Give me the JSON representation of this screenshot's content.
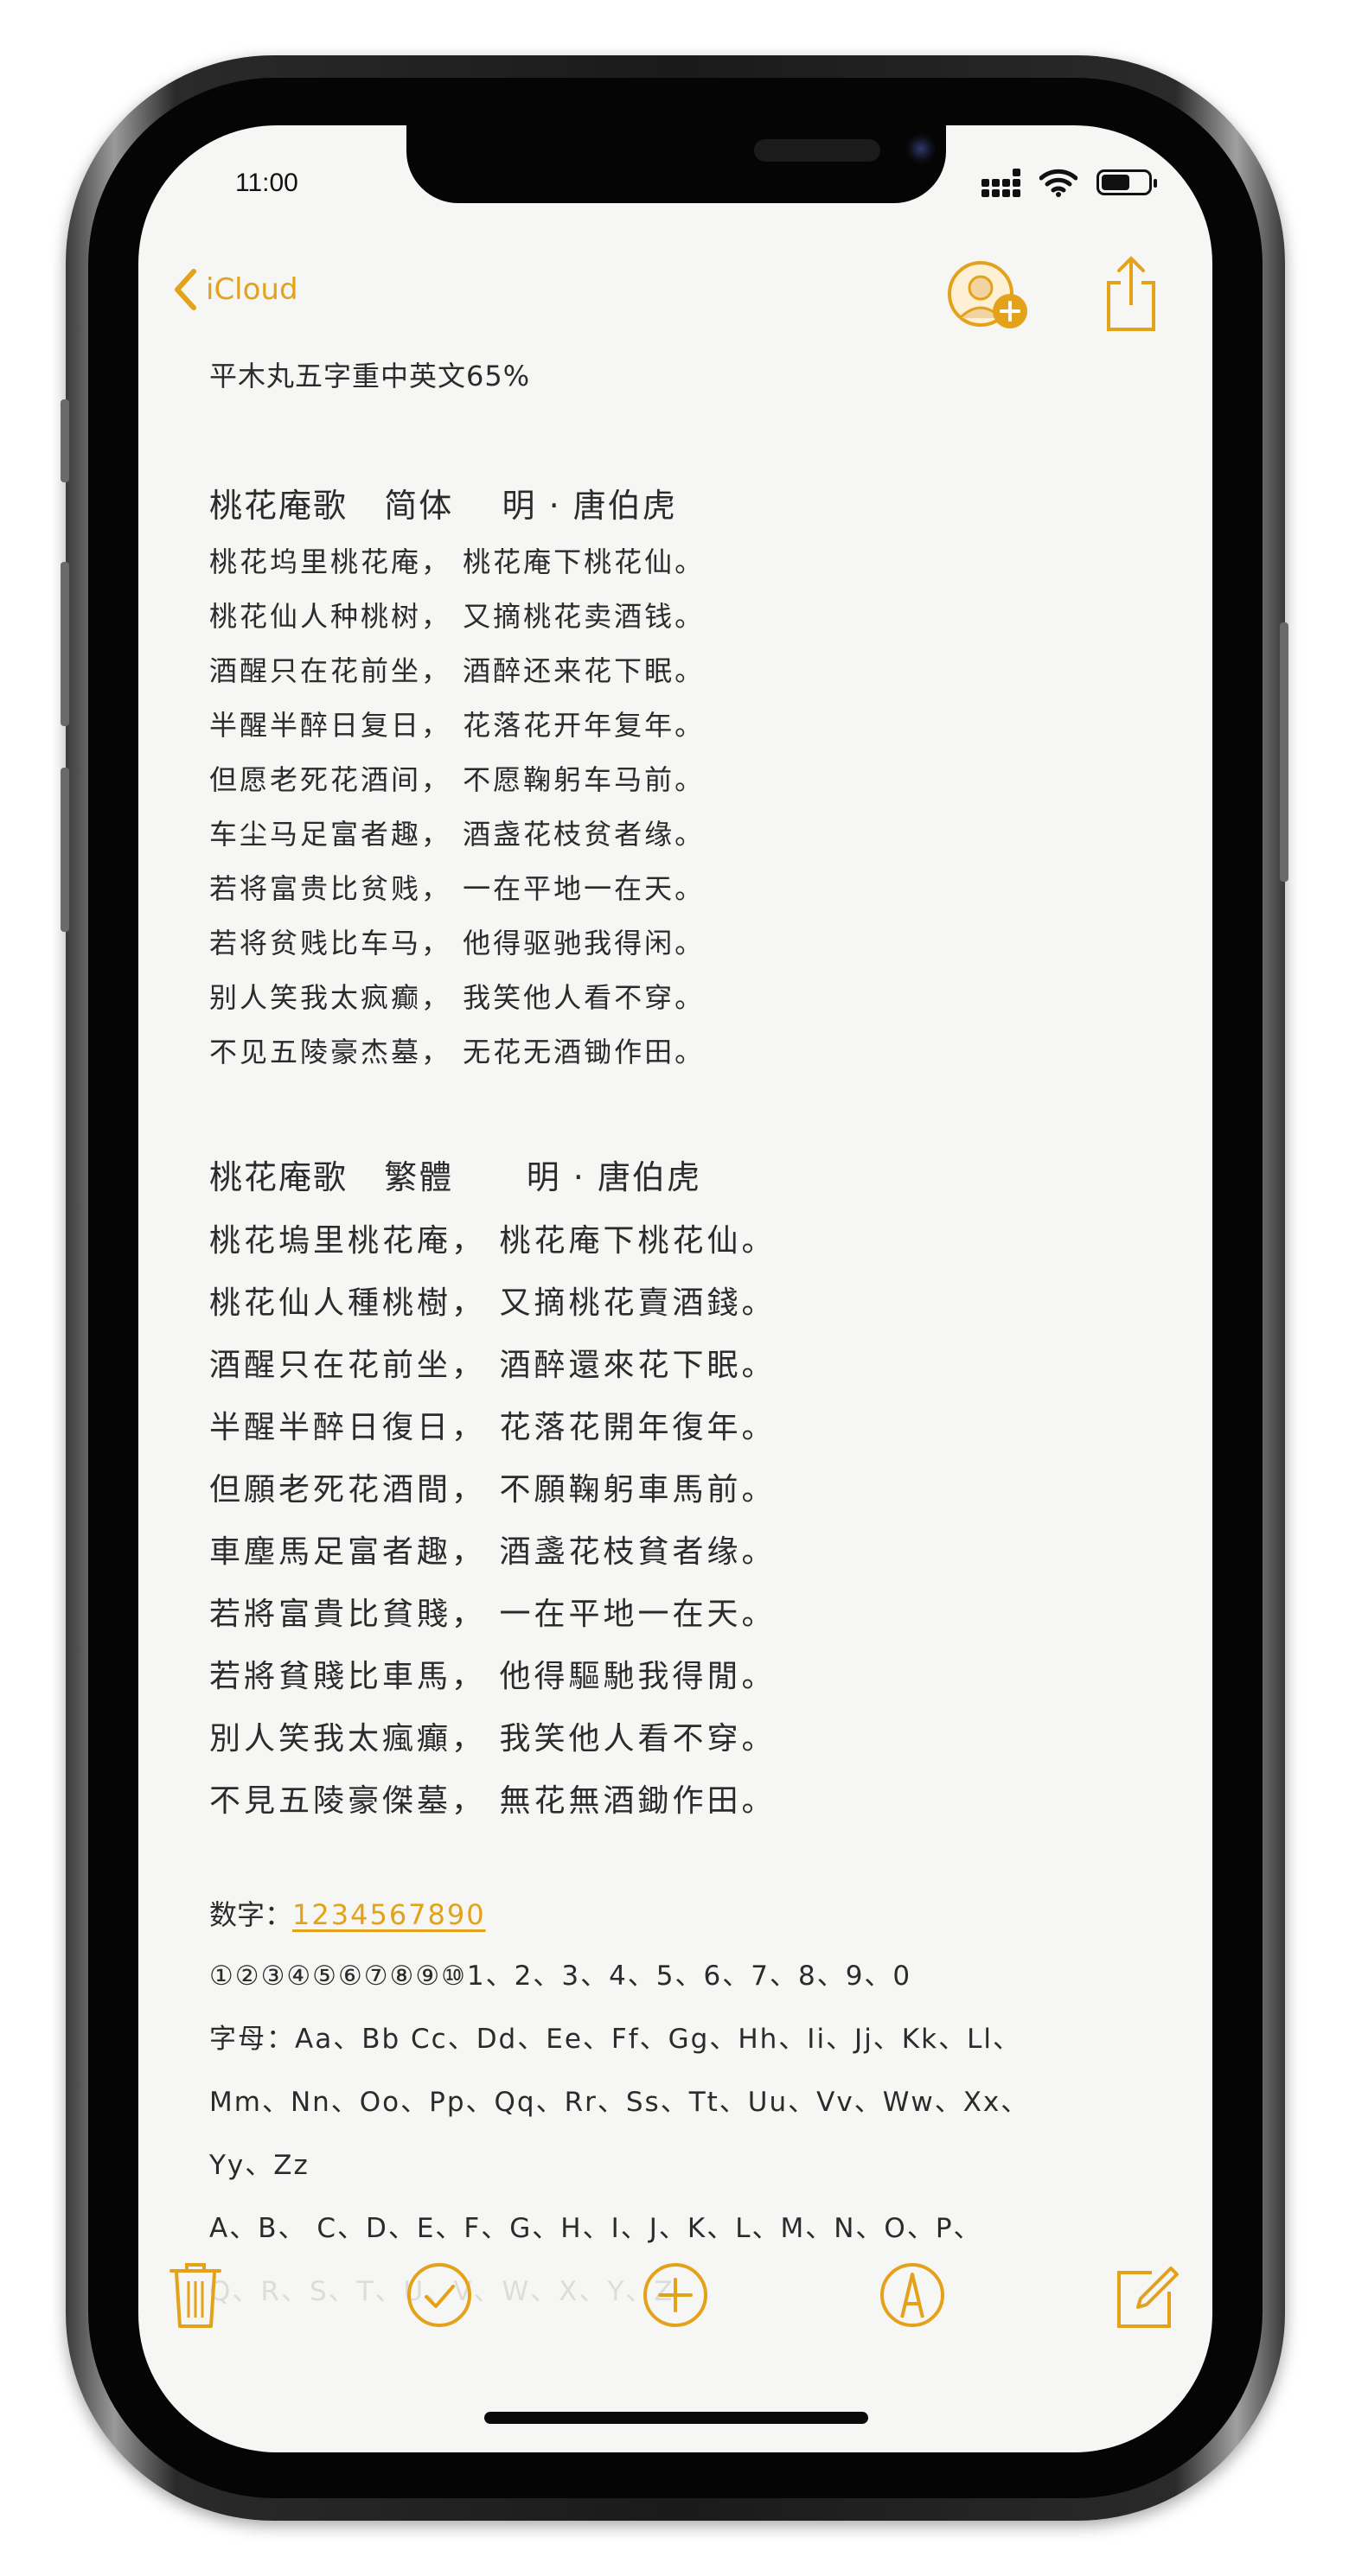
{
  "status_bar": {
    "time": "11:00",
    "battery_level": 0.65
  },
  "nav": {
    "back_label": "iCloud",
    "back_icon": "chevron-left-icon",
    "people_icon": "add-person-icon",
    "share_icon": "share-icon"
  },
  "colors": {
    "accent": "#e3a21a",
    "text": "#2b2b2b",
    "paper": "#f6f6f4"
  },
  "note": {
    "font_note": "平木丸五字重中英文65%",
    "poem_simplified": {
      "title": "桃花庵歌   简体    明 · 唐伯虎",
      "lines": [
        "桃花坞里桃花庵， 桃花庵下桃花仙。",
        "桃花仙人种桃树， 又摘桃花卖酒钱。",
        "酒醒只在花前坐， 酒醉还来花下眠。",
        "半醒半醉日复日， 花落花开年复年。",
        "但愿老死花酒间， 不愿鞠躬车马前。",
        "车尘马足富者趣， 酒盏花枝贫者缘。",
        "若将富贵比贫贱， 一在平地一在天。",
        "若将贫贱比车马， 他得驱驰我得闲。",
        "别人笑我太疯癫， 我笑他人看不穿。",
        "不见五陵豪杰墓， 无花无酒锄作田。"
      ]
    },
    "poem_traditional": {
      "title": "桃花庵歌   繁體      明 · 唐伯虎",
      "lines": [
        "桃花塢里桃花庵， 桃花庵下桃花仙。",
        "桃花仙人種桃樹， 又摘桃花賣酒錢。",
        "酒醒只在花前坐， 酒醉還來花下眠。",
        "半醒半醉日復日， 花落花開年復年。",
        "但願老死花酒間， 不願鞠躬車馬前。",
        "車塵馬足富者趣， 酒盞花枝貧者缘。",
        "若將富貴比貧賤， 一在平地一在天。",
        "若將貧賤比車馬， 他得驅馳我得閒。",
        "別人笑我太瘋癲， 我笑他人看不穿。",
        "不見五陵豪傑墓， 無花無酒鋤作田。"
      ]
    },
    "numbers_label": "数字：",
    "numbers_link": "1234567890",
    "circled_numbers": "①②③④⑤⑥⑦⑧⑨⑩1、2、3、4、5、6、7、8、9、0",
    "letters_line1": "字母：Aa、Bb Cc、Dd、Ee、Ff、Gg、Hh、Ii、Jj、Kk、Ll、",
    "letters_line2": "Mm、Nn、Oo、Pp、Qq、Rr、Ss、Tt、Uu、Vv、Ww、Xx、",
    "letters_line3": "Yy、Zz",
    "letters_line4": "A、B、 C、D、E、F、G、H、I、J、K、L、M、N、O、P、",
    "letters_line5_faded": "Q、R、S、T、U、V、W、X、Y、Z"
  },
  "toolbar": {
    "items": [
      "trash-icon",
      "checklist-icon",
      "add-icon",
      "markup-icon",
      "compose-icon"
    ]
  }
}
